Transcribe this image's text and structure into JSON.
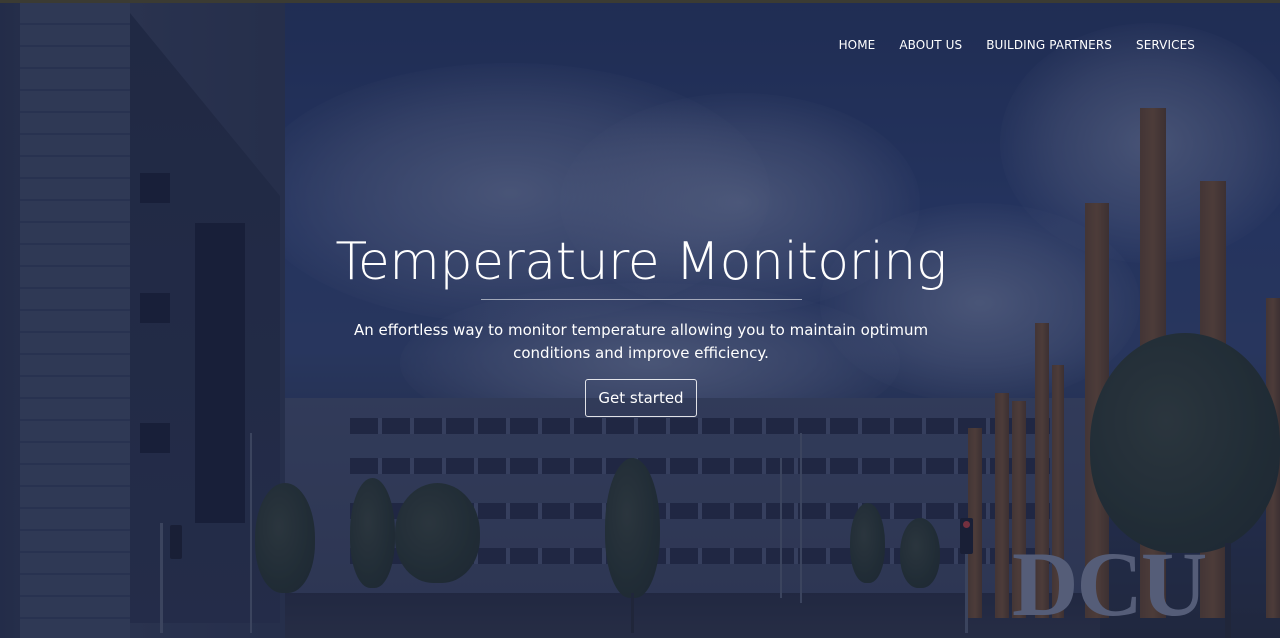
{
  "nav": {
    "items": [
      {
        "label": "HOME"
      },
      {
        "label": "ABOUT US"
      },
      {
        "label": "BUILDING PARTNERS"
      },
      {
        "label": "SERVICES"
      }
    ]
  },
  "hero": {
    "title": "Temperature Monitoring",
    "subtitle": "An effortless way to monitor temperature allowing you to maintain optimum conditions and improve efficiency.",
    "cta_label": "Get started",
    "sign_text": "DCU"
  },
  "colors": {
    "overlay": "#141c3e",
    "text": "#ffffff"
  }
}
